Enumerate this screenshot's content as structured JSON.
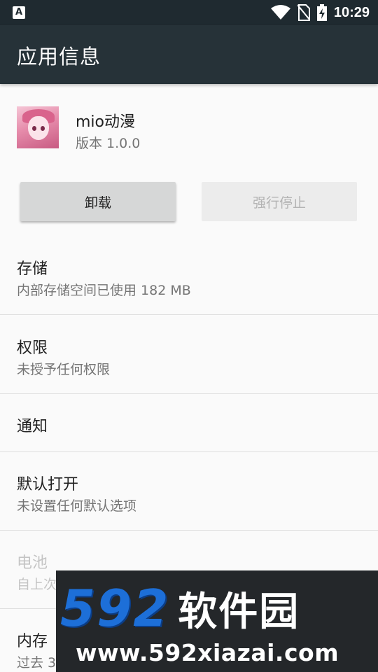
{
  "status_bar": {
    "notification_glyph": "A",
    "icons": [
      "wifi-icon",
      "no-sim-icon",
      "battery-charging-icon"
    ],
    "time": "10:29"
  },
  "app_bar": {
    "title": "应用信息"
  },
  "app": {
    "name": "mio动漫",
    "version": "版本 1.0.0"
  },
  "buttons": {
    "uninstall": "卸载",
    "force_stop": "强行停止"
  },
  "items": [
    {
      "title": "存储",
      "subtitle": "内部存储空间已使用 182 MB"
    },
    {
      "title": "权限",
      "subtitle": "未授予任何权限"
    },
    {
      "title": "通知"
    },
    {
      "title": "默认打开",
      "subtitle": "未设置任何默认选项"
    },
    {
      "title": "电池",
      "subtitle": "自上次",
      "disabled": true
    },
    {
      "title": "内存",
      "subtitle": "过去 3"
    }
  ],
  "watermark": {
    "logo_number": "592",
    "logo_text": "软件园",
    "url": "www.592xiazai.com"
  },
  "colors": {
    "status_bar": "#1f2a30",
    "app_bar": "#263238",
    "background": "#fafafa",
    "watermark_blue": "#1d6fd8"
  }
}
